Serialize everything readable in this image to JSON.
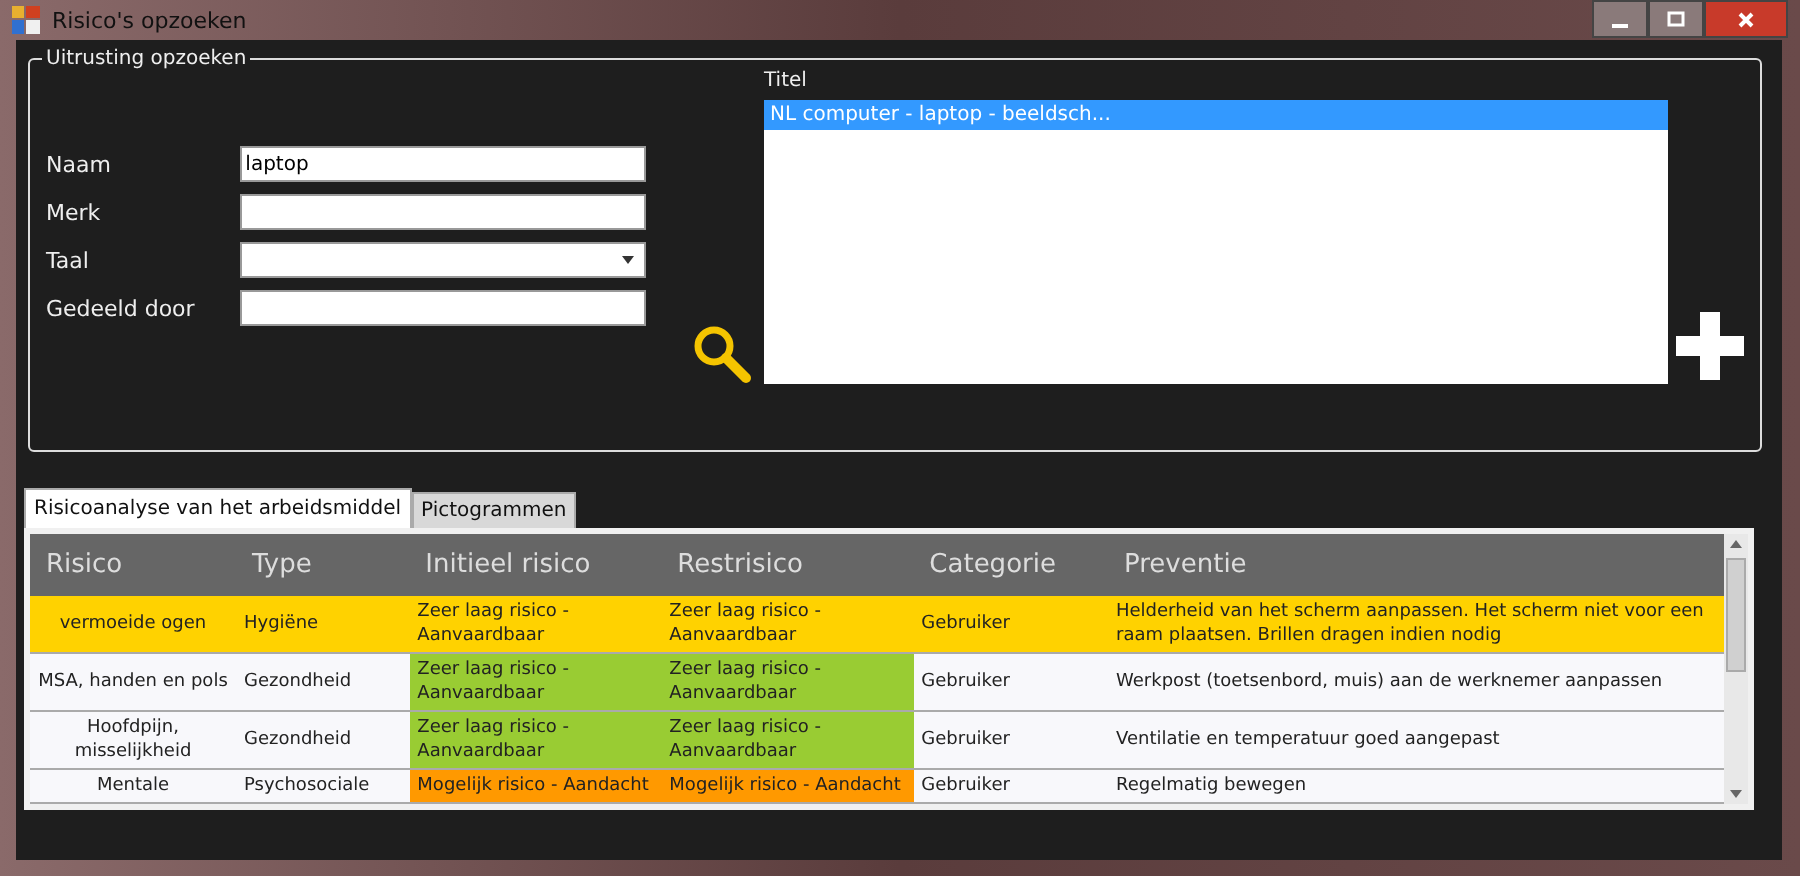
{
  "window": {
    "title": "Risico's opzoeken"
  },
  "search_group": {
    "title": "Uitrusting opzoeken",
    "fields": [
      {
        "label": "Naam",
        "kind": "text",
        "value": "laptop"
      },
      {
        "label": "Merk",
        "kind": "text"
      },
      {
        "label": "Taal",
        "kind": "dropdown"
      },
      {
        "label": "Gedeeld door",
        "kind": "text"
      }
    ],
    "results": {
      "label": "Titel",
      "items": [
        {
          "text": "NL computer - laptop - beeldsch...",
          "selected": true
        }
      ]
    }
  },
  "tabs": [
    {
      "label": "Risicoanalyse van het arbeidsmiddel",
      "selected": true
    },
    {
      "label": "Pictogrammen",
      "selected": false
    }
  ],
  "table": {
    "columns": [
      "Risico",
      "Type",
      "Initieel risico",
      "Restrisico",
      "Categorie",
      "Preventie"
    ],
    "rows": [
      {
        "selected": true,
        "risico": "vermoeide ogen",
        "type": "Hygiëne",
        "initieel": {
          "text": "Zeer laag risico - Aanvaardbaar"
        },
        "rest": {
          "text": "Zeer laag risico - Aanvaardbaar"
        },
        "categorie": "Gebruiker",
        "preventie": "Helderheid van het scherm aanpassen. Het scherm niet voor een raam plaatsen. Brillen dragen indien nodig"
      },
      {
        "selected": false,
        "risico": "MSA, handen en pols",
        "type": "Gezondheid",
        "initieel": {
          "text": "Zeer laag risico - Aanvaardbaar",
          "color": "#99cc33"
        },
        "rest": {
          "text": "Zeer laag risico - Aanvaardbaar",
          "color": "#99cc33"
        },
        "categorie": "Gebruiker",
        "preventie": "Werkpost (toetsenbord, muis) aan de werknemer aanpassen"
      },
      {
        "selected": false,
        "risico": "Hoofdpijn, misselijkheid",
        "type": "Gezondheid",
        "initieel": {
          "text": "Zeer laag risico - Aanvaardbaar",
          "color": "#99cc33"
        },
        "rest": {
          "text": "Zeer laag risico - Aanvaardbaar",
          "color": "#99cc33"
        },
        "categorie": "Gebruiker",
        "preventie": "Ventilatie en temperatuur goed aangepast"
      },
      {
        "selected": false,
        "risico": "Mentale",
        "type": "Psychosociale",
        "initieel": {
          "text": "Mogelijk risico - Aandacht",
          "color": "#ff9900"
        },
        "rest": {
          "text": "Mogelijk risico - Aandacht",
          "color": "#ff9900"
        },
        "categorie": "Gebruiker",
        "preventie": "Regelmatig bewegen"
      }
    ]
  }
}
